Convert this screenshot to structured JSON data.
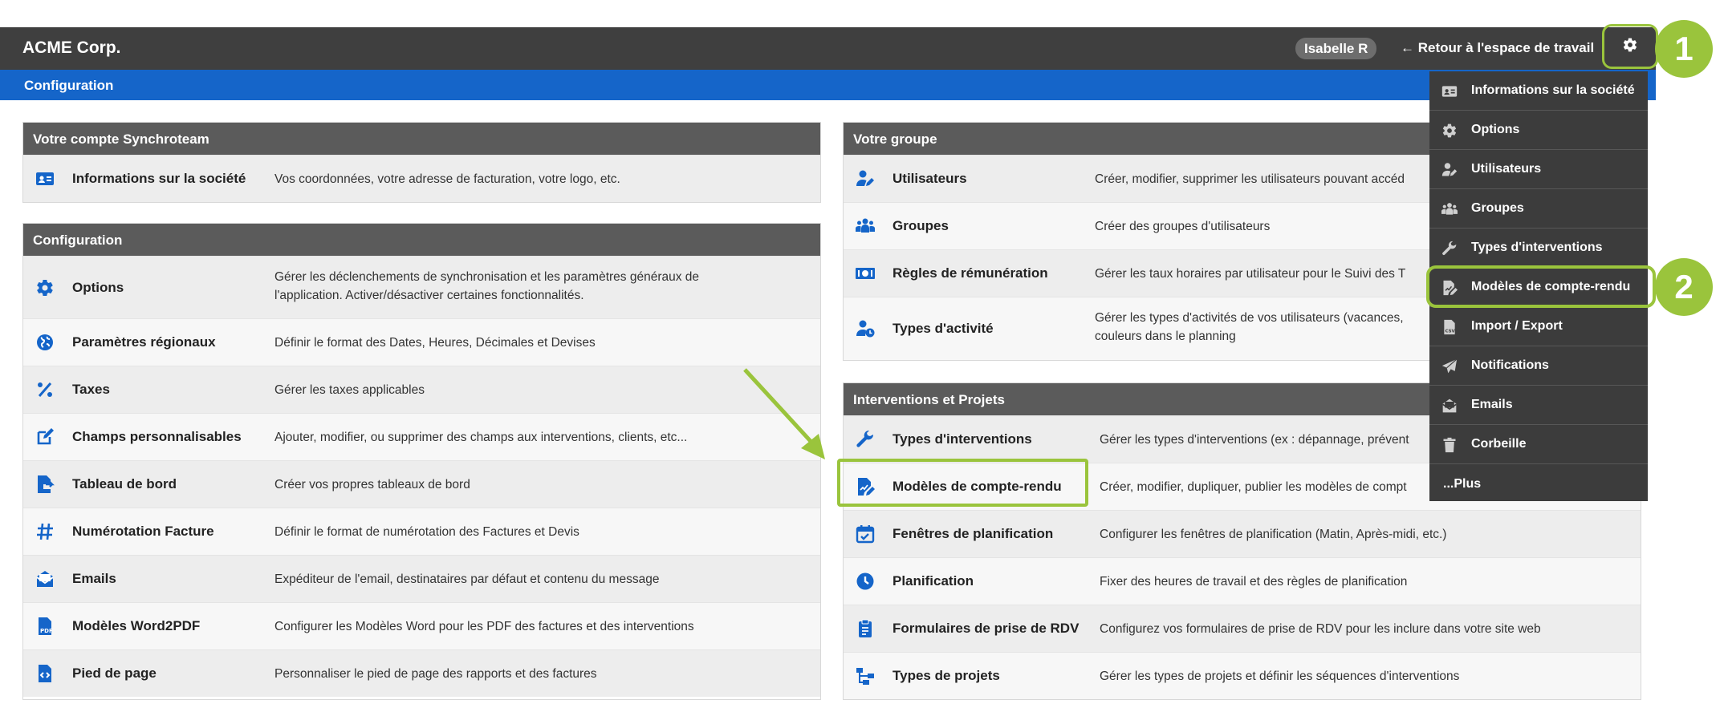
{
  "header": {
    "brand": "ACME Corp.",
    "user": "Isabelle R",
    "back_link": "← Retour à l'espace de travail",
    "settings_icon": "gear-icon"
  },
  "subheader": {
    "title": "Configuration"
  },
  "panels": {
    "account": {
      "title": "Votre compte Synchroteam",
      "rows": [
        {
          "icon": "id-card-icon",
          "name": "Informations sur la société",
          "desc": "Vos coordonnées, votre adresse de facturation, votre logo, etc."
        }
      ]
    },
    "config": {
      "title": "Configuration",
      "rows": [
        {
          "icon": "gear-icon",
          "name": "Options",
          "desc": "Gérer les déclenchements de synchronisation et les paramètres généraux de",
          "desc2": "l'application. Activer/désactiver certaines fonctionnalités."
        },
        {
          "icon": "globe-icon",
          "name": "Paramètres régionaux",
          "desc": "Définir le format des Dates, Heures, Décimales et Devises"
        },
        {
          "icon": "percent-icon",
          "name": "Taxes",
          "desc": "Gérer les taxes applicables"
        },
        {
          "icon": "edit-icon",
          "name": "Champs personnalisables",
          "desc": "Ajouter, modifier, ou supprimer des champs aux interventions, clients, etc..."
        },
        {
          "icon": "dashboard-icon",
          "name": "Tableau de bord",
          "desc": "Créer vos propres tableaux de bord"
        },
        {
          "icon": "hash-icon",
          "name": "Numérotation Facture",
          "desc": "Définir le format de numérotation des Factures et Devis"
        },
        {
          "icon": "email-icon",
          "name": "Emails",
          "desc": "Expéditeur de l'email, destinataires par défaut et contenu du message"
        },
        {
          "icon": "pdf-icon",
          "name": "Modèles Word2PDF",
          "desc": "Configurer les Modèles Word pour les PDF des factures et des interventions"
        },
        {
          "icon": "footer-icon",
          "name": "Pied de page",
          "desc": "Personnaliser le pied de page des rapports et des factures"
        }
      ]
    },
    "group": {
      "title": "Votre groupe",
      "rows": [
        {
          "icon": "user-edit-icon",
          "name": "Utilisateurs",
          "desc": "Créer, modifier, supprimer les utilisateurs pouvant accéd"
        },
        {
          "icon": "users-icon",
          "name": "Groupes",
          "desc": "Créer des groupes d'utilisateurs"
        },
        {
          "icon": "money-icon",
          "name": "Règles de rémunération",
          "desc": "Gérer les taux horaires par utilisateur pour le Suivi des T"
        },
        {
          "icon": "user-clock-icon",
          "name": "Types d'activité",
          "desc": "Gérer les types d'activités de vos utilisateurs (vacances,",
          "desc2": "couleurs dans le planning"
        }
      ]
    },
    "projects": {
      "title": "Interventions et Projets",
      "rows": [
        {
          "icon": "wrench-icon",
          "name": "Types d'interventions",
          "desc": "Gérer les types d'interventions (ex : dépannage, prévent"
        },
        {
          "icon": "report-icon",
          "name": "Modèles de compte-rendu",
          "desc": "Créer, modifier, dupliquer, publier les modèles de compt"
        },
        {
          "icon": "calendar-icon",
          "name": "Fenêtres de planification",
          "desc": "Configurer les fenêtres de planification (Matin, Après-midi, etc.)"
        },
        {
          "icon": "clock-icon",
          "name": "Planification",
          "desc": "Fixer des heures de travail et des règles de planification"
        },
        {
          "icon": "clipboard-icon",
          "name": "Formulaires de prise de RDV",
          "desc": "Configurez vos formulaires de prise de RDV pour les inclure dans votre site web"
        },
        {
          "icon": "sitemap-icon",
          "name": "Types de projets",
          "desc": "Gérer les types de projets et définir les séquences d'interventions"
        }
      ]
    }
  },
  "dropdown": {
    "items": [
      {
        "icon": "id-card-icon",
        "label": "Informations sur la société"
      },
      {
        "icon": "gear-icon",
        "label": "Options"
      },
      {
        "icon": "user-edit-icon",
        "label": "Utilisateurs"
      },
      {
        "icon": "users-icon",
        "label": "Groupes"
      },
      {
        "icon": "wrench-icon",
        "label": "Types d'interventions"
      },
      {
        "icon": "report-icon",
        "label": "Modèles de compte-rendu"
      },
      {
        "icon": "csv-icon",
        "label": "Import / Export"
      },
      {
        "icon": "send-icon",
        "label": "Notifications"
      },
      {
        "icon": "email-icon",
        "label": "Emails"
      },
      {
        "icon": "trash-icon",
        "label": "Corbeille"
      },
      {
        "icon": "more-icon",
        "label": "...Plus"
      }
    ]
  },
  "annotations": {
    "step1": "1",
    "step2": "2",
    "accent": "#9ac43c"
  },
  "colors": {
    "topbar": "#3f3f3f",
    "subbar": "#1565c9",
    "icon_blue": "#1565c9",
    "panel_head": "#5b5b5b",
    "dropdown": "#3c3c3c"
  }
}
